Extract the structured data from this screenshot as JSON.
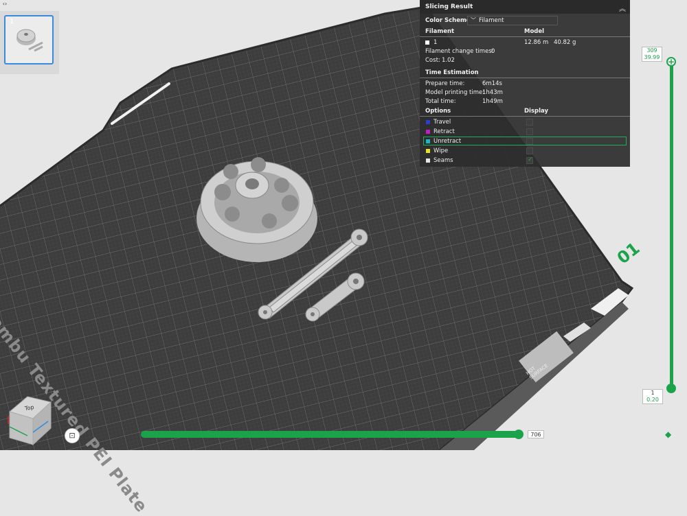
{
  "thumbnail": {
    "plate_number": "1"
  },
  "plate": {
    "label": "Bambu Textured PEI Plate",
    "plate_id": "01",
    "hot_surface": "HOT SURFACE"
  },
  "view_cube": {
    "face": "Top"
  },
  "slicing_result": {
    "title": "Slicing Result",
    "color_scheme_label": "Color Scheme",
    "color_scheme_value": "Filament",
    "filament_header": "Filament",
    "model_header": "Model",
    "filament_id": "1",
    "filament_length": "12.86 m",
    "filament_weight": "40.82 g",
    "change_times_label": "Filament change times:",
    "change_times_value": "0",
    "cost_label": "Cost:",
    "cost_value": "1.02",
    "time_header": "Time Estimation",
    "prepare_label": "Prepare time:",
    "prepare_value": "6m14s",
    "model_time_label": "Model printing time:",
    "model_time_value": "1h43m",
    "total_label": "Total time:",
    "total_value": "1h49m",
    "options_header": "Options",
    "display_header": "Display",
    "options": [
      {
        "label": "Travel",
        "color": "#2b3fcf",
        "checked": false
      },
      {
        "label": "Retract",
        "color": "#c21cc2",
        "checked": false
      },
      {
        "label": "Unretract",
        "color": "#1fb4c8",
        "checked": false
      },
      {
        "label": "Wipe",
        "color": "#e8e022",
        "checked": false
      },
      {
        "label": "Seams",
        "color": "#e8e8e8",
        "checked": true
      }
    ]
  },
  "layer_slider": {
    "top_layer": "309",
    "top_height": "39.99",
    "bottom_layer": "1",
    "bottom_height": "0.20"
  },
  "move_slider": {
    "value": "706"
  },
  "colors": {
    "accent": "#1aa34a",
    "plate": "#3f3f3f",
    "panel": "#2d2d2d"
  }
}
